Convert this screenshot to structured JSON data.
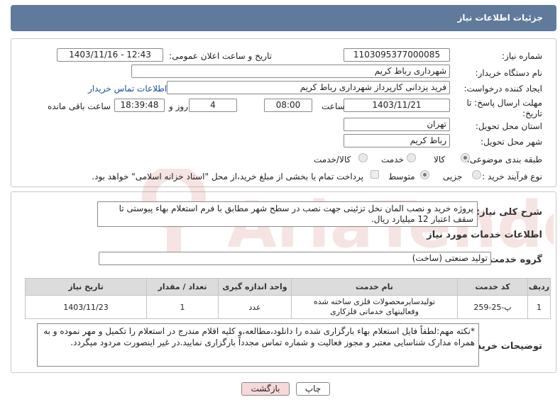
{
  "header": {
    "title": "جزئیات اطلاعات نیاز"
  },
  "form": {
    "need_number_label": "شماره نیاز:",
    "need_number": "1103095377000085",
    "announce_label": "تاریخ و ساعت اعلان عمومی:",
    "announce_value": "1403/11/16 - 12:43",
    "buyer_org_label": "نام دستگاه خریدار:",
    "buyer_org": "شهرداری رباط کریم",
    "creator_label": "ایجاد کننده درخواست:",
    "creator": "فرید یزدانی کارپرداز شهرداری رباط کریم",
    "contact_link": "اطلاعات تماس خریدار",
    "deadline_label": "مهلت ارسال پاسخ: تا تاریخ:",
    "deadline_date": "1403/11/21",
    "time_label": "ساعت",
    "deadline_time": "08:00",
    "days_value": "4",
    "days_label": "روز و",
    "remain_time": "18:39:48",
    "remain_label": "ساعت باقی مانده",
    "province_label": "استان محل تحویل:",
    "province": "تهران",
    "city_label": "شهر محل تحویل:",
    "city": "رباط کریم",
    "category_label": "طبقه بندی موضوعی:",
    "cat_goods": "کالا",
    "cat_service": "خدمت",
    "cat_both": "کالا/خدمت",
    "process_label": "نوع فرآیند خرید :",
    "proc_small": "جزیی",
    "proc_medium": "متوسط",
    "treasury_note": "پرداخت تمام یا بخشی از مبلغ خرید،از محل \"اسناد خزانه اسلامی\" خواهد بود."
  },
  "details": {
    "desc_label": "شرح کلی نیاز:",
    "desc_text": "پروژه خرید و نصب المان نخل تزئینی جهت نصب در سطح شهر مطابق با فرم استعلام بهاء پیوستی تا سقف اعتبار 12 میلیارد ریال.",
    "services_title": "اطلاعات خدمات مورد نیاز",
    "group_label": "گروه خدمت:",
    "group_value": "تولید صنعتی (ساخت)",
    "table": {
      "headers": [
        "ردیف",
        "کد خدمت",
        "نام خدمت",
        "واحد اندازه گیری",
        "تعداد / مقدار",
        "تاریخ نیاز"
      ],
      "rows": [
        [
          "1",
          "پ-25-259",
          "تولیدسایرمحصولات فلزی ساخته شده وفعالیتهای خدماتی فلزکاری",
          "عدد",
          "1",
          "1403/11/23"
        ]
      ]
    },
    "buyer_notes_label": "توضیحات خریدار:",
    "buyer_notes": "*نکته مهم:لطفاً فایل استعلام بهاء بارگزاری شده را دانلود،مطالعه،و کلیه اقلام مندرج در استعلام را تکمیل و مهر نموده و به همراه مدارک شناسایی معتبر و مجوز فعالیت و شماره تماس مجدداً بارگزاری نمایید.در غیر اینصورت مردود میگردد."
  },
  "buttons": {
    "print": "چاپ",
    "back": "بازگشت"
  },
  "colors": {
    "header_bg": "#5f7a9b",
    "back_btn_bg": "#f8d9d9",
    "watermark": "#c0392b"
  }
}
